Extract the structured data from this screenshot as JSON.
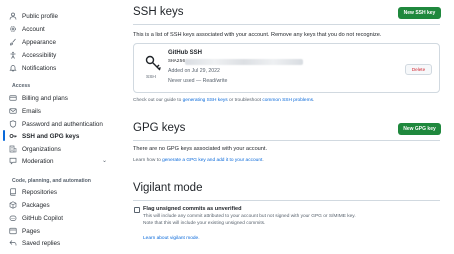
{
  "sidebar": {
    "items_top": [
      {
        "label": "Public profile",
        "icon": "person-icon"
      },
      {
        "label": "Account",
        "icon": "gear-icon"
      },
      {
        "label": "Appearance",
        "icon": "paintbrush-icon"
      },
      {
        "label": "Accessibility",
        "icon": "accessibility-icon"
      },
      {
        "label": "Notifications",
        "icon": "bell-icon"
      }
    ],
    "section_access": "Access",
    "items_access": [
      {
        "label": "Billing and plans",
        "icon": "credit-card-icon"
      },
      {
        "label": "Emails",
        "icon": "mail-icon"
      },
      {
        "label": "Password and authentication",
        "icon": "shield-lock-icon"
      },
      {
        "label": "SSH and GPG keys",
        "icon": "key-icon"
      },
      {
        "label": "Organizations",
        "icon": "organization-icon"
      },
      {
        "label": "Moderation",
        "icon": "report-icon"
      }
    ],
    "section_code": "Code, planning, and automation",
    "items_code": [
      {
        "label": "Repositories",
        "icon": "repo-icon"
      },
      {
        "label": "Packages",
        "icon": "package-icon"
      },
      {
        "label": "GitHub Copilot",
        "icon": "copilot-icon"
      },
      {
        "label": "Pages",
        "icon": "browser-icon"
      },
      {
        "label": "Saved replies",
        "icon": "reply-icon"
      }
    ]
  },
  "ssh": {
    "title": "SSH keys",
    "new_button": "New SSH key",
    "description": "This is a list of SSH keys associated with your account. Remove any keys that you do not recognize.",
    "key": {
      "title": "GitHub SSH",
      "type": "SSH",
      "fingerprint_prefix": "SHA256:",
      "added": "Added on Jul 29, 2022",
      "used": "Never used — Read/write",
      "delete_label": "Delete"
    },
    "guide_prefix": "Check out our guide to ",
    "guide_link1": "generating SSH keys",
    "guide_middle": " or troubleshoot ",
    "guide_link2": "common SSH problems",
    "guide_suffix": "."
  },
  "gpg": {
    "title": "GPG keys",
    "new_button": "New GPG key",
    "empty": "There are no GPG keys associated with your account.",
    "learn_prefix": "Learn how to ",
    "learn_link": "generate a GPG key and add it to your account",
    "learn_suffix": "."
  },
  "vigilant": {
    "title": "Vigilant mode",
    "checkbox_label": "Flag unsigned commits as unverified",
    "desc1": "This will include any commit attributed to your account but not signed with your GPG or S/MIME key.",
    "desc2": "Note that this will include your existing unsigned commits.",
    "learn_link": "Learn about vigilant mode."
  },
  "colors": {
    "accent": "#0969da",
    "primary_button": "#1f883d",
    "danger": "#d1242f"
  }
}
